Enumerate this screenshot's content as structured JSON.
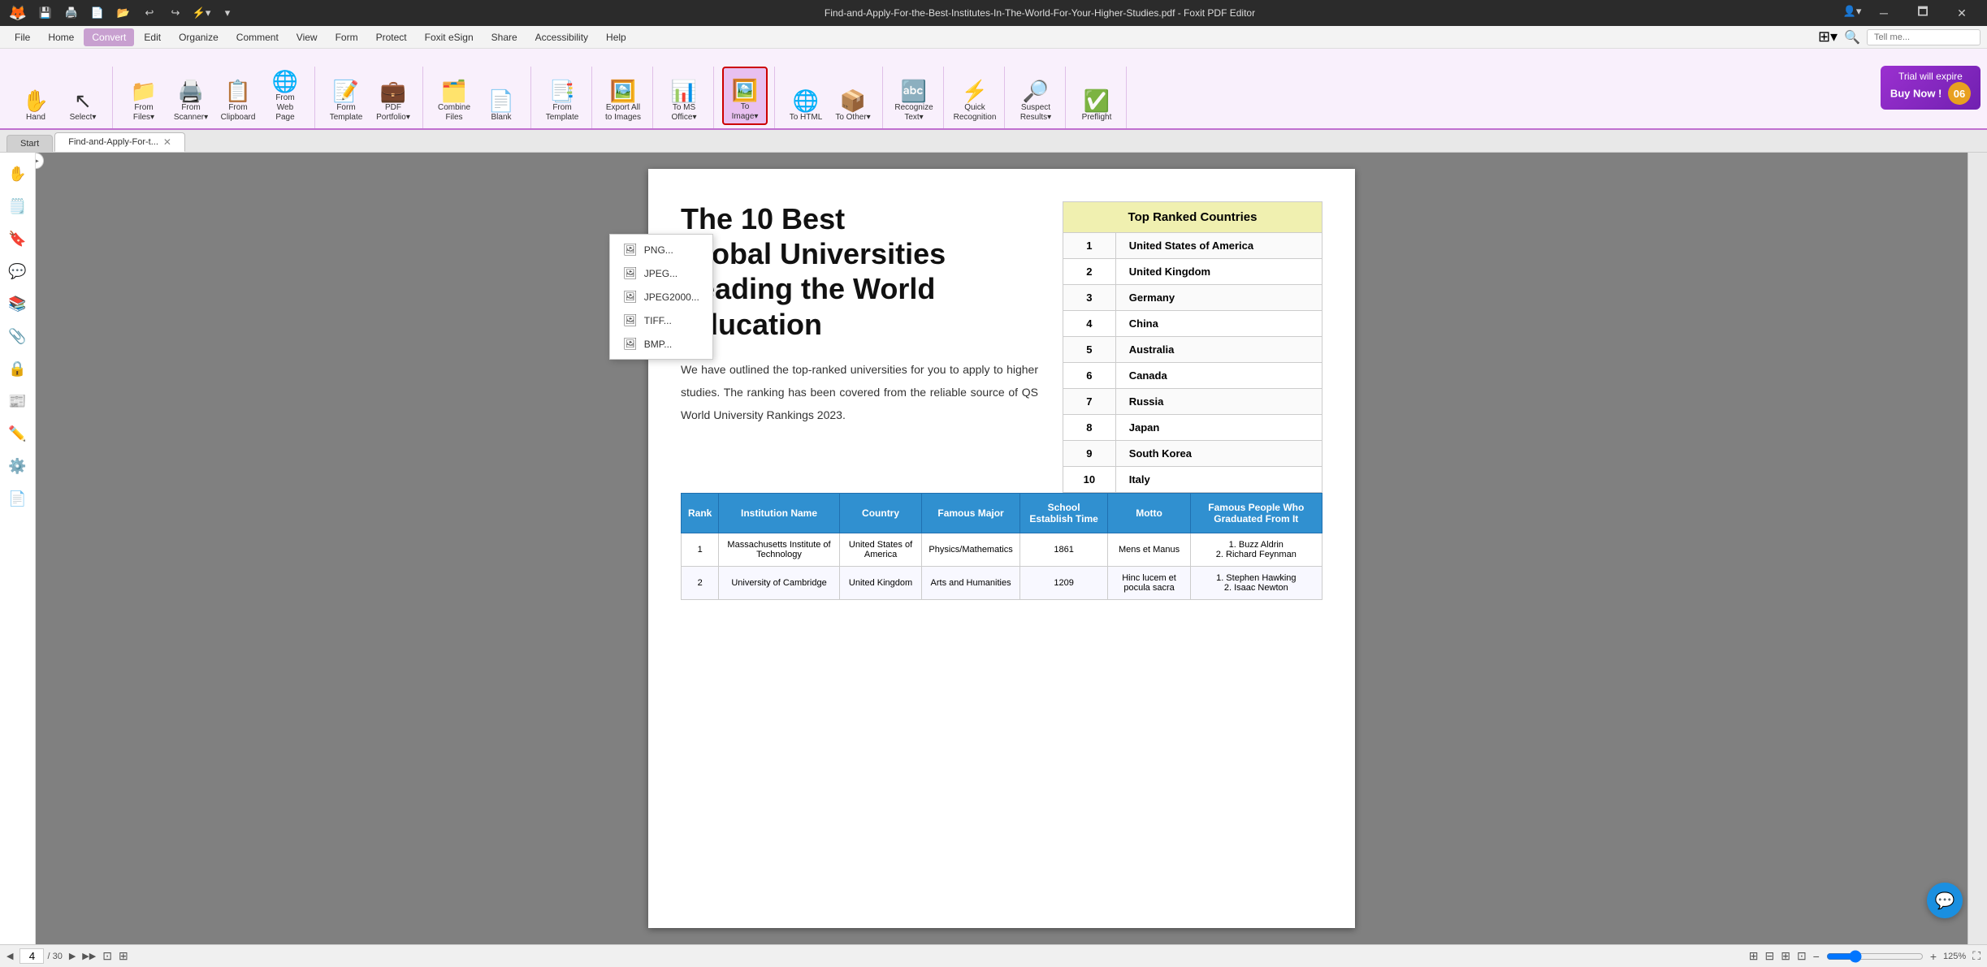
{
  "titlebar": {
    "title": "Find-and-Apply-For-the-Best-Institutes-In-The-World-For-Your-Higher-Studies.pdf - Foxit PDF Editor",
    "app_icon": "🦊"
  },
  "quickaccess": {
    "buttons": [
      "💾",
      "🖨️",
      "📄",
      "🔒",
      "↩️",
      "↪️",
      "⚡"
    ]
  },
  "menubar": {
    "items": [
      "File",
      "Home",
      "Convert",
      "Edit",
      "Organize",
      "Comment",
      "View",
      "Form",
      "Protect",
      "Foxit eSign",
      "Share",
      "Accessibility",
      "Help"
    ],
    "active": "Convert"
  },
  "ribbon": {
    "groups": [
      {
        "name": "hand-select",
        "buttons": [
          {
            "id": "hand",
            "label": "Hand",
            "icon": "✋",
            "dropdown": false
          },
          {
            "id": "select",
            "label": "Select",
            "icon": "↖️",
            "dropdown": true
          }
        ]
      },
      {
        "name": "from-group",
        "buttons": [
          {
            "id": "from-files",
            "label": "From Files",
            "icon": "📂",
            "dropdown": true
          },
          {
            "id": "from-scanner",
            "label": "From Scanner",
            "icon": "🖨️",
            "dropdown": true
          },
          {
            "id": "from-clipboard",
            "label": "From Clipboard",
            "icon": "📋",
            "dropdown": false
          },
          {
            "id": "from-webpage",
            "label": "From Web Page",
            "icon": "🌐",
            "dropdown": false
          }
        ]
      },
      {
        "name": "form-pdf",
        "buttons": [
          {
            "id": "form",
            "label": "Form Template",
            "icon": "📝",
            "dropdown": false
          },
          {
            "id": "pdf-portfolio",
            "label": "PDF Portfolio",
            "icon": "💼",
            "dropdown": true
          }
        ]
      },
      {
        "name": "combine-blank",
        "buttons": [
          {
            "id": "combine",
            "label": "Combine Files",
            "icon": "🗂️",
            "dropdown": false
          },
          {
            "id": "blank",
            "label": "Blank",
            "icon": "📄",
            "dropdown": false
          }
        ]
      },
      {
        "name": "from-template",
        "buttons": [
          {
            "id": "from-template",
            "label": "From Template",
            "icon": "📑",
            "dropdown": false
          }
        ]
      },
      {
        "name": "export",
        "buttons": [
          {
            "id": "export-all",
            "label": "Export All to Images",
            "icon": "🖼️",
            "dropdown": false
          }
        ]
      },
      {
        "name": "to-office",
        "buttons": [
          {
            "id": "to-ms-office",
            "label": "To MS Office",
            "icon": "📊",
            "dropdown": true
          }
        ]
      },
      {
        "name": "to-image",
        "buttons": [
          {
            "id": "to-image",
            "label": "To Image",
            "icon": "🖼️",
            "dropdown": true,
            "active": true
          }
        ]
      },
      {
        "name": "to-html-other",
        "buttons": [
          {
            "id": "to-html",
            "label": "To HTML",
            "icon": "🌐",
            "dropdown": false
          },
          {
            "id": "to-other",
            "label": "To Other",
            "icon": "📦",
            "dropdown": true
          }
        ]
      },
      {
        "name": "recognize",
        "buttons": [
          {
            "id": "recognize-text",
            "label": "Recognize Text",
            "icon": "🔤",
            "dropdown": true
          }
        ]
      },
      {
        "name": "quick-recognition",
        "buttons": [
          {
            "id": "quick-recognition",
            "label": "Quick Recognition",
            "icon": "⚡",
            "dropdown": false
          }
        ]
      },
      {
        "name": "suspect-results",
        "buttons": [
          {
            "id": "suspect-results",
            "label": "Suspect Results",
            "icon": "🔍",
            "dropdown": true
          }
        ]
      },
      {
        "name": "preflight",
        "buttons": [
          {
            "id": "preflight",
            "label": "Preflight",
            "icon": "✅",
            "dropdown": false
          }
        ]
      }
    ]
  },
  "trial": {
    "line1": "Trial will expire",
    "line2": "Buy Now !",
    "days": "06"
  },
  "tabs": [
    {
      "label": "Start",
      "active": false,
      "closable": false
    },
    {
      "label": "Find-and-Apply-For-t...",
      "active": true,
      "closable": true
    }
  ],
  "dropdown": {
    "items": [
      {
        "label": "PNG...",
        "icon": "🖼️"
      },
      {
        "label": "JPEG...",
        "icon": "🖼️"
      },
      {
        "label": "JPEG2000...",
        "icon": "🖼️"
      },
      {
        "label": "TIFF...",
        "icon": "🖼️"
      },
      {
        "label": "BMP...",
        "icon": "🖼️"
      }
    ]
  },
  "sidebar_icons": [
    "📄",
    "☰",
    "💬",
    "📚",
    "🔖",
    "✏️",
    "🔒",
    "📌",
    "⚙️"
  ],
  "pdf": {
    "title": "The 10 Best\nGlobal Universities\nLeading the World\nEducation",
    "body": "We have outlined the top-ranked universities for you to apply to higher studies. The ranking has been covered from the reliable source of QS World University Rankings 2023.",
    "top_table": {
      "header": "Top Ranked Countries",
      "rows": [
        {
          "rank": "1",
          "country": "United States of America"
        },
        {
          "rank": "2",
          "country": "United Kingdom"
        },
        {
          "rank": "3",
          "country": "Germany"
        },
        {
          "rank": "4",
          "country": "China"
        },
        {
          "rank": "5",
          "country": "Australia"
        },
        {
          "rank": "6",
          "country": "Canada"
        },
        {
          "rank": "7",
          "country": "Russia"
        },
        {
          "rank": "8",
          "country": "Japan"
        },
        {
          "rank": "9",
          "country": "South Korea"
        },
        {
          "rank": "10",
          "country": "Italy"
        }
      ]
    },
    "bottom_table": {
      "headers": [
        "Rank",
        "Institution Name",
        "Country",
        "Famous Major",
        "School Establish Time",
        "Motto",
        "Famous People Who Graduated From It"
      ],
      "rows": [
        {
          "rank": "1",
          "name": "Massachusetts Institute of Technology",
          "country": "United States of America",
          "major": "Physics/Mathematics",
          "year": "1861",
          "motto": "Mens et Manus",
          "famous": "1. Buzz Aldrin\n2. Richard Feynman"
        },
        {
          "rank": "2",
          "name": "University of Cambridge",
          "country": "United Kingdom",
          "major": "Arts and Humanities",
          "year": "1209",
          "motto": "Hinc lucem et pocula sacra",
          "famous": "1. Stephen Hawking\n2. Isaac Newton"
        }
      ]
    }
  },
  "statusbar": {
    "page_nav": "4 / 30",
    "zoom": "125%",
    "icons_left": [
      "◀",
      "▶",
      "▶▶",
      "⊡",
      "⊞"
    ],
    "icons_right": [
      "⊞",
      "⊟",
      "⊞",
      "⊡"
    ]
  },
  "search": {
    "placeholder": "Tell me..."
  }
}
